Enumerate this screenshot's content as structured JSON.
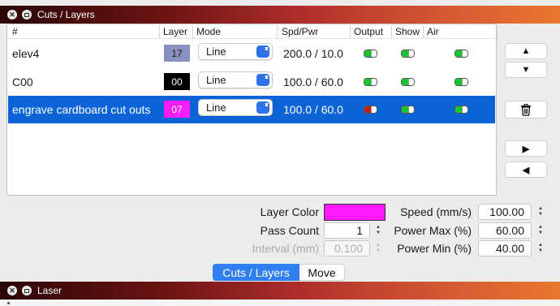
{
  "window": {
    "title": "Cuts / Layers"
  },
  "bottom_window": {
    "title": "Laser"
  },
  "table": {
    "headers": {
      "name": "#",
      "layer": "Layer",
      "mode": "Mode",
      "spdpwr": "Spd/Pwr",
      "output": "Output",
      "show": "Show",
      "air": "Air"
    },
    "rows": [
      {
        "name": "elev4",
        "layer": "17",
        "layer_color": "#8891bf",
        "layer_text_color": "#1a1a1a",
        "mode": "Line",
        "spdpwr": "200.0 / 10.0",
        "output": "on",
        "show": "on",
        "air": "on"
      },
      {
        "name": "C00",
        "layer": "00",
        "layer_color": "#000000",
        "layer_text_color": "#ffffff",
        "mode": "Line",
        "spdpwr": "100.0 / 60.0",
        "output": "on",
        "show": "on",
        "air": "on"
      },
      {
        "name": "engrave cardboard cut outs",
        "layer": "07",
        "layer_color": "#f81cf8",
        "layer_text_color": "#ffffff",
        "mode": "Line",
        "spdpwr": "100.0 / 60.0",
        "output": "off",
        "show": "on",
        "air": "on",
        "selected": true
      }
    ]
  },
  "side_buttons": {
    "up_icon": "chevron-up-icon",
    "down_icon": "chevron-down-icon",
    "delete_icon": "trash-icon",
    "right_icon": "chevron-right-icon",
    "left_icon": "chevron-left-icon"
  },
  "settings": {
    "layer_color_label": "Layer Color",
    "layer_color": "#ff19ff",
    "pass_count_label": "Pass Count",
    "pass_count": "1",
    "interval_label": "Interval (mm)",
    "interval": "0.100",
    "speed_label": "Speed (mm/s)",
    "speed": "100.00",
    "power_max_label": "Power Max (%)",
    "power_max": "60.00",
    "power_min_label": "Power Min (%)",
    "power_min": "40.00"
  },
  "tabs": [
    {
      "label": "Cuts / Layers",
      "active": true
    },
    {
      "label": "Move",
      "active": false
    }
  ],
  "colors": {
    "selection": "#0a64d8",
    "accent": "#2f7ff0",
    "toggle_on": "#16c42e",
    "toggle_off": "#c0201c"
  }
}
